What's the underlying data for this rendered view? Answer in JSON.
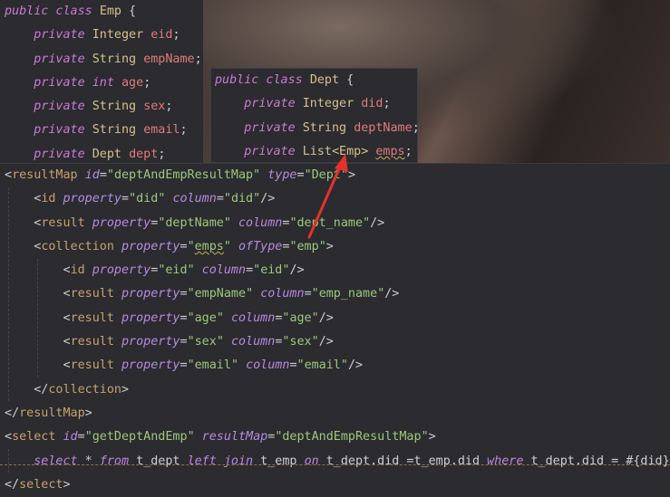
{
  "emp_class": {
    "header": [
      "public",
      " class ",
      "Emp",
      " {"
    ],
    "fields": [
      {
        "mod": "private",
        "type": "Integer",
        "name": "eid"
      },
      {
        "mod": "private",
        "type": "String",
        "name": "empName"
      },
      {
        "mod": "private",
        "type": "int",
        "name": "age"
      },
      {
        "mod": "private",
        "type": "String",
        "name": "sex"
      },
      {
        "mod": "private",
        "type": "String",
        "name": "email"
      },
      {
        "mod": "private",
        "type": "Dept",
        "name": "dept"
      }
    ]
  },
  "dept_class": {
    "header": [
      "public",
      " class ",
      "Dept",
      " {"
    ],
    "fields": [
      {
        "mod": "private",
        "type": "Integer",
        "name": "did"
      },
      {
        "mod": "private",
        "type": "String",
        "name": "deptName"
      },
      {
        "mod": "private",
        "type": "List<Emp>",
        "name": "emps"
      }
    ]
  },
  "xml": {
    "result_map_id": "deptAndEmpResultMap",
    "result_map_type": "Dept",
    "id_property": "did",
    "id_column": "did",
    "r1_property": "deptName",
    "r1_column": "dept_name",
    "collection_property": "emps",
    "collection_oftype": "emp",
    "c_id_property": "eid",
    "c_id_column": "eid",
    "c1_property": "empName",
    "c1_column": "emp_name",
    "c2_property": "age",
    "c2_column": "age",
    "c3_property": "sex",
    "c3_column": "sex",
    "c4_property": "email",
    "c4_column": "email",
    "select_id": "getDeptAndEmp",
    "select_result_map": "deptAndEmpResultMap",
    "sql": {
      "select": "select",
      "star": " * ",
      "from": "from",
      "t1": " t_dept ",
      "left_join": "left join",
      "t2": " t_emp ",
      "on": "on",
      "cond": " t_dept.did =t_emp.did ",
      "where": "where",
      "tail": " t_dept.did = #{did}"
    }
  },
  "arrow_color": "#e5322d"
}
